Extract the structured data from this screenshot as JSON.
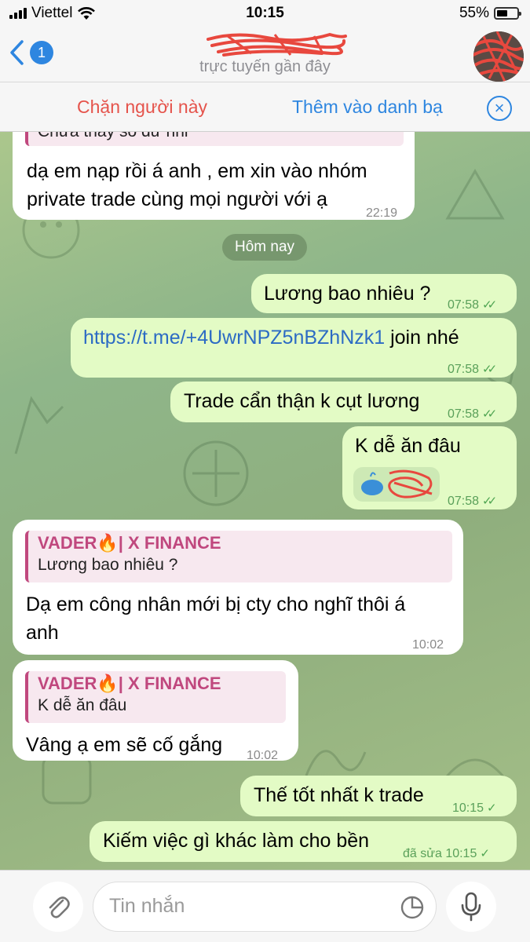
{
  "status_bar": {
    "carrier": "Viettel",
    "time": "10:15",
    "battery": "55%",
    "battery_level": 0.55
  },
  "header": {
    "back_badge": "1",
    "contact_status": "trực tuyến gần đây"
  },
  "action_bar": {
    "block_label": "Chặn người này",
    "add_contact_label": "Thêm vào danh bạ"
  },
  "messages": [
    {
      "dir": "in",
      "reply_text": "Chưa thấy số dư nhỉ",
      "lines": [
        "dạ em nạp rồi á anh , em xin vào nhóm",
        "private trade cùng mọi người với ạ"
      ],
      "time": "22:19"
    },
    {
      "date_label": "Hôm nay"
    },
    {
      "dir": "out",
      "text": "Lương bao nhiêu ?",
      "time": "07:58"
    },
    {
      "dir": "out",
      "link": "https://t.me/+4UwrNPZ5nBZhNzk1",
      "text": " join nhé",
      "time": "07:58"
    },
    {
      "dir": "out",
      "text": "Trade cẩn thận k cụt lương",
      "time": "07:58"
    },
    {
      "dir": "out",
      "text": "K dễ ăn đâu",
      "time": "07:58"
    },
    {
      "dir": "in",
      "reply_name": "VADER🔥| X FINANCE",
      "reply_text": "Lương bao nhiêu ?",
      "lines": [
        "Dạ em công nhân mới bị cty cho nghĩ thôi á",
        "anh"
      ],
      "time": "10:02"
    },
    {
      "dir": "in",
      "reply_name": "VADER🔥| X FINANCE",
      "reply_text": "K dễ ăn đâu",
      "text": "Vâng ạ em sẽ cố gắng",
      "time": "10:02"
    },
    {
      "dir": "out",
      "text": "Thế tốt nhất k trade",
      "time": "10:15"
    },
    {
      "dir": "out",
      "text": "Kiếm việc gì khác làm cho bền",
      "edited": "đã sửa",
      "time": "10:15"
    }
  ],
  "input": {
    "placeholder": "Tin nhắn"
  },
  "colors": {
    "accent": "#2e86e0",
    "danger": "#e5534b",
    "outgoing_bubble": "#e3fbc5",
    "reply_accent": "#c0487e"
  },
  "icons": [
    "chevron-left-icon",
    "wifi-icon",
    "paperclip-icon",
    "sticker-icon",
    "microphone-icon",
    "close-circle-icon",
    "double-check-icon",
    "single-check-icon"
  ]
}
